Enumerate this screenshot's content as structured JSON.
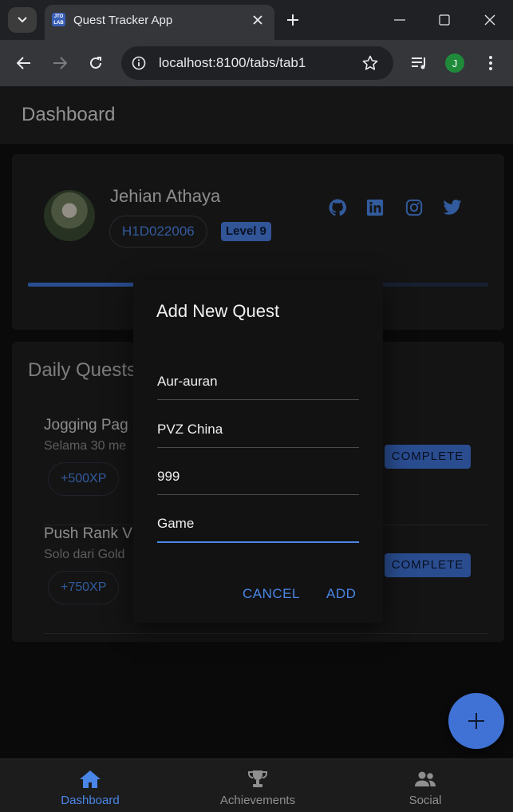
{
  "browser": {
    "tab_title": "Quest Tracker App",
    "favicon_text": "JTO LAB",
    "url": "localhost:8100/tabs/tab1",
    "profile_initial": "J"
  },
  "header": {
    "title": "Dashboard"
  },
  "profile": {
    "name": "Jehian Athaya",
    "nim": "H1D022006",
    "level": "Level 9",
    "social_icons": [
      "github-icon",
      "linkedin-icon",
      "instagram-icon",
      "twitter-icon"
    ],
    "xp_progress": 0.23
  },
  "daily_quests": {
    "title": "Daily Quests",
    "items": [
      {
        "name": "Jogging Pag",
        "desc": "Selama 30 me",
        "xp": "+500XP",
        "action": "COMPLETE"
      },
      {
        "name": "Push Rank V",
        "desc": "Solo dari Gold",
        "xp": "+750XP",
        "action": "COMPLETE"
      }
    ]
  },
  "dialog": {
    "title": "Add New Quest",
    "fields": [
      "Aur-auran",
      "PVZ China",
      "999",
      "Game"
    ],
    "cancel_label": "CANCEL",
    "add_label": "ADD"
  },
  "tabs": [
    {
      "label": "Dashboard",
      "icon": "home-icon",
      "active": true
    },
    {
      "label": "Achievements",
      "icon": "trophy-icon",
      "active": false
    },
    {
      "label": "Social",
      "icon": "people-icon",
      "active": false
    }
  ],
  "colors": {
    "accent": "#4a86e8",
    "primary": "#3f72d4"
  }
}
